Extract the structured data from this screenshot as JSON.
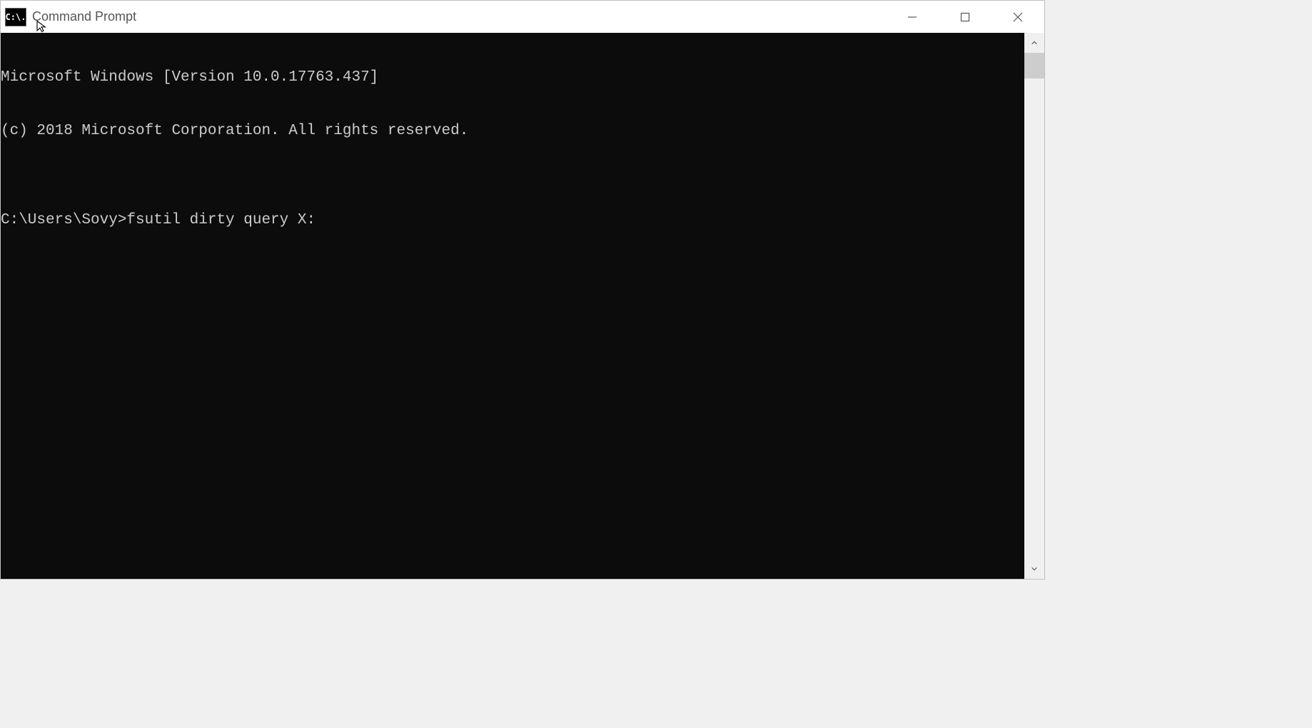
{
  "window": {
    "title": "Command Prompt",
    "icon_label": "C:\\."
  },
  "terminal": {
    "lines": [
      "Microsoft Windows [Version 10.0.17763.437]",
      "(c) 2018 Microsoft Corporation. All rights reserved.",
      "",
      "C:\\Users\\Sovy>fsutil dirty query X:"
    ]
  }
}
